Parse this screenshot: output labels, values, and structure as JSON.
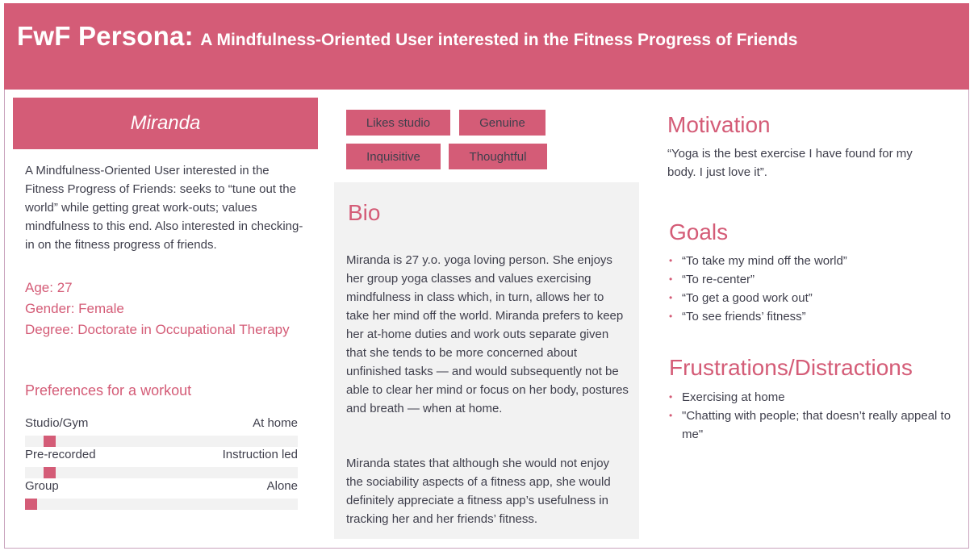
{
  "header": {
    "title_main": "FwF Persona:",
    "title_sub": "A Mindfulness-Oriented User interested in the Fitness Progress of Friends"
  },
  "persona": {
    "name": "Miranda",
    "summary": "A Mindfulness-Oriented User interested in the Fitness Progress of Friends: seeks to “tune out the world” while getting great work-outs; values mindfulness to this end. Also interested in checking-in on the fitness progress of friends.",
    "age_label": "Age:",
    "age_value": "27",
    "gender_label": "Gender:",
    "gender_value": "Female",
    "degree_label": "Degree",
    "degree_value": ": Doctorate in Occupational Therapy"
  },
  "preferences": {
    "title": "Preferences for a workout",
    "items": [
      {
        "left": "Studio/Gym",
        "right": "At home",
        "level": 0.07
      },
      {
        "left": "Pre-recorded",
        "right": "Instruction led",
        "level": 0.07
      },
      {
        "left": "Group",
        "right": "Alone",
        "level": 0.0
      }
    ]
  },
  "tags": [
    "Likes studio",
    "Genuine",
    "Inquisitive",
    "Thoughtful"
  ],
  "bio": {
    "title": "Bio",
    "paragraph1": "Miranda is 27 y.o. yoga loving person. She enjoys her group yoga classes and values exercising mindfulness in class which, in turn, allows her to take her mind off the world. Miranda prefers to keep her at-home duties and work outs separate given that she tends to be more concerned about unfinished tasks — and would subsequently not be able to clear her mind or focus on her body, postures and breath — when at home.",
    "paragraph2": "Miranda states that although she would not enjoy the sociability aspects of a fitness app, she would definitely appreciate a fitness app’s usefulness in tracking her and her friends’ fitness."
  },
  "motivation": {
    "title": "Motivation",
    "quote": "“Yoga is the best exercise I have found for my body. I just love it”."
  },
  "goals": {
    "title": "Goals",
    "items": [
      "“To take my mind off the world”",
      "“To re-center”",
      "“To get a good work out”",
      "“To see friends’ fitness”"
    ]
  },
  "frustrations": {
    "title": "Frustrations/Distractions",
    "items": [
      "Exercising at home",
      "\"Chatting with people; that doesn’t really appeal to me\""
    ]
  },
  "colors": {
    "accent": "#d45c77",
    "panel": "#f2f2f2",
    "text": "#3f3f4c"
  }
}
